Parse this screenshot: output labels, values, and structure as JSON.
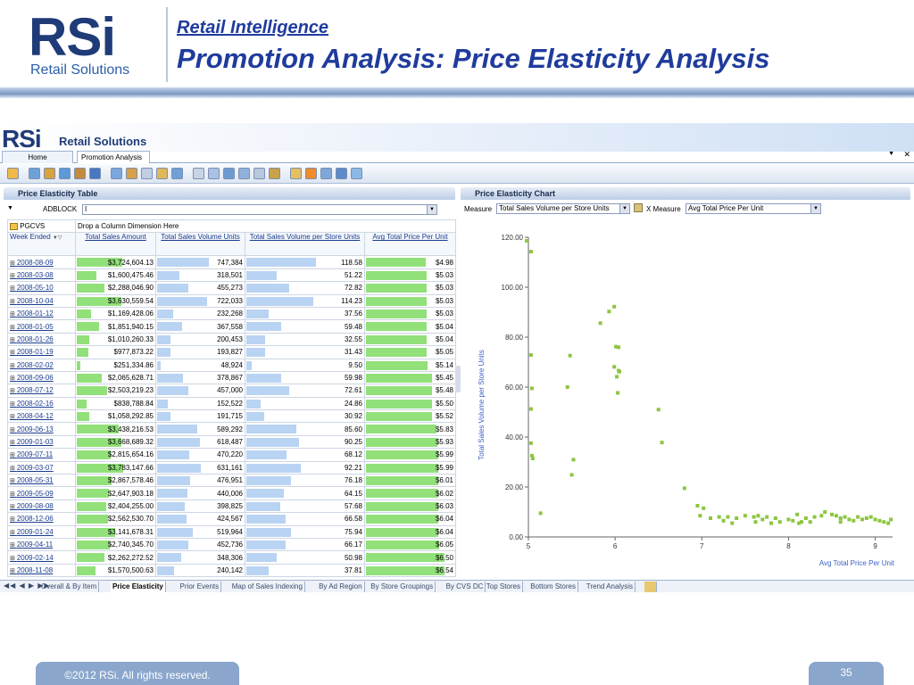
{
  "slide": {
    "logo_text": "RSi",
    "logo_sub": "Retail Solutions",
    "kicker": "Retail Intelligence",
    "title": "Promotion Analysis: Price Elasticity Analysis",
    "footer": "©2012 RSi. All rights reserved.",
    "page_number": "35"
  },
  "app": {
    "brand": "RSi",
    "brand_sub": "Retail Solutions",
    "tabs": [
      "Home",
      "Promotion Analysis"
    ],
    "left_panel_title": "Price Elasticity Table",
    "right_panel_title": "Price Elasticity Chart",
    "filter_label": "ADBLOCK",
    "filter_value": "I",
    "pgcvs_label": "PGCVS",
    "drop_hint": "Drop a Column Dimension Here",
    "row_header": "Week Ended",
    "columns": [
      "Total Sales Amount",
      "Total Sales Volume Units",
      "Total Sales Volume per Store Units",
      "Avg Total Price Per Unit"
    ],
    "rows": [
      [
        "2008-08-09",
        "$3,724,604.13",
        "747,384",
        "118.58",
        "$4.98"
      ],
      [
        "2008-03-08",
        "$1,600,475.46",
        "318,501",
        "51.22",
        "$5.03"
      ],
      [
        "2008-05-10",
        "$2,288,046.90",
        "455,273",
        "72.82",
        "$5.03"
      ],
      [
        "2008-10-04",
        "$3,630,559.54",
        "722,033",
        "114.23",
        "$5.03"
      ],
      [
        "2008-01-12",
        "$1,169,428.06",
        "232,268",
        "37.56",
        "$5.03"
      ],
      [
        "2008-01-05",
        "$1,851,940.15",
        "367,558",
        "59.48",
        "$5.04"
      ],
      [
        "2008-01-26",
        "$1,010,260.33",
        "200,453",
        "32.55",
        "$5.04"
      ],
      [
        "2008-01-19",
        "$977,873.22",
        "193,827",
        "31.43",
        "$5.05"
      ],
      [
        "2008-02-02",
        "$251,334.86",
        "48,924",
        "9.50",
        "$5.14"
      ],
      [
        "2008-09-06",
        "$2,065,628.71",
        "378,867",
        "59.98",
        "$5.45"
      ],
      [
        "2008-07-12",
        "$2,503,219.23",
        "457,000",
        "72.61",
        "$5.48"
      ],
      [
        "2008-02-16",
        "$838,788.84",
        "152,522",
        "24.86",
        "$5.50"
      ],
      [
        "2008-04-12",
        "$1,058,292.85",
        "191,715",
        "30.92",
        "$5.52"
      ],
      [
        "2009-06-13",
        "$3,438,216.53",
        "589,292",
        "85.60",
        "$5.83"
      ],
      [
        "2009-01-03",
        "$3,668,689.32",
        "618,487",
        "90.25",
        "$5.93"
      ],
      [
        "2009-07-11",
        "$2,815,654.16",
        "470,220",
        "68.12",
        "$5.99"
      ],
      [
        "2009-03-07",
        "$3,783,147.66",
        "631,161",
        "92.21",
        "$5.99"
      ],
      [
        "2008-05-31",
        "$2,867,578.46",
        "476,951",
        "76.18",
        "$6.01"
      ],
      [
        "2009-05-09",
        "$2,647,903.18",
        "440,006",
        "64.15",
        "$6.02"
      ],
      [
        "2009-08-08",
        "$2,404,255.00",
        "398,825",
        "57.68",
        "$6.03"
      ],
      [
        "2008-12-06",
        "$2,562,530.70",
        "424,567",
        "66.58",
        "$6.04"
      ],
      [
        "2009-01-24",
        "$3,141,678.31",
        "519,964",
        "75.94",
        "$6.04"
      ],
      [
        "2009-04-11",
        "$2,740,345.70",
        "452,736",
        "66.17",
        "$6.05"
      ],
      [
        "2009-02-14",
        "$2,262,272.52",
        "348,306",
        "50.98",
        "$6.50"
      ],
      [
        "2008-11-08",
        "$1,570,500.63",
        "240,142",
        "37.81",
        "$6.54"
      ]
    ],
    "measure_label": "Measure",
    "measure_value": "Total Sales Volume per Store Units",
    "x_measure_label": "X Measure",
    "x_measure_value": "Avg Total Price Per Unit",
    "bottom_tabs": [
      "Overall & By Item",
      "Price Elasticity",
      "Prior Events",
      "Map of Sales Indexing",
      "By Ad Region",
      "By Store Groupings",
      "By CVS DC",
      "Top Stores",
      "Bottom Stores",
      "Trend Analysis"
    ]
  },
  "colors": {
    "brand": "#1f3b78",
    "bar_green": "#92e07a",
    "bar_blue": "#b9d3f3",
    "point": "#8cc63f",
    "axis_title": "#3b5fc5"
  },
  "chart_data": {
    "type": "scatter",
    "xlabel": "Avg Total Price Per Unit",
    "ylabel": "Total Sales Volume per Store Units",
    "xlim": [
      5,
      9.2
    ],
    "ylim": [
      0,
      120
    ],
    "x_ticks": [
      "5",
      "6",
      "7",
      "8",
      "9"
    ],
    "y_ticks": [
      "0.00",
      "20.00",
      "40.00",
      "60.00",
      "80.00",
      "100.00",
      "120.00"
    ],
    "grid": false,
    "points": [
      [
        4.98,
        118.58
      ],
      [
        5.03,
        114.23
      ],
      [
        5.03,
        72.82
      ],
      [
        5.03,
        51.22
      ],
      [
        5.03,
        37.56
      ],
      [
        5.04,
        59.48
      ],
      [
        5.04,
        32.55
      ],
      [
        5.05,
        31.43
      ],
      [
        5.14,
        9.5
      ],
      [
        5.45,
        59.98
      ],
      [
        5.48,
        72.61
      ],
      [
        5.5,
        24.86
      ],
      [
        5.52,
        30.92
      ],
      [
        5.83,
        85.6
      ],
      [
        5.93,
        90.25
      ],
      [
        5.99,
        68.12
      ],
      [
        5.99,
        92.21
      ],
      [
        6.01,
        76.18
      ],
      [
        6.02,
        64.15
      ],
      [
        6.03,
        57.68
      ],
      [
        6.04,
        66.58
      ],
      [
        6.04,
        75.94
      ],
      [
        6.05,
        66.17
      ],
      [
        6.5,
        50.98
      ],
      [
        6.54,
        37.81
      ],
      [
        6.8,
        19.5
      ],
      [
        6.95,
        12.5
      ],
      [
        6.98,
        8.5
      ],
      [
        7.02,
        11.5
      ],
      [
        7.1,
        7.5
      ],
      [
        7.2,
        8
      ],
      [
        7.25,
        6.5
      ],
      [
        7.3,
        8
      ],
      [
        7.35,
        5.5
      ],
      [
        7.4,
        7.5
      ],
      [
        7.5,
        8.5
      ],
      [
        7.6,
        8
      ],
      [
        7.62,
        6
      ],
      [
        7.65,
        8.5
      ],
      [
        7.7,
        7
      ],
      [
        7.75,
        8
      ],
      [
        7.8,
        5.5
      ],
      [
        7.85,
        7.5
      ],
      [
        7.9,
        6
      ],
      [
        8.0,
        7
      ],
      [
        8.05,
        6.5
      ],
      [
        8.1,
        9
      ],
      [
        8.15,
        6
      ],
      [
        8.2,
        7.5
      ],
      [
        8.25,
        6
      ],
      [
        8.3,
        8
      ],
      [
        8.38,
        8.5
      ],
      [
        8.42,
        10
      ],
      [
        8.5,
        9
      ],
      [
        8.55,
        8.5
      ],
      [
        8.6,
        7.5
      ],
      [
        8.65,
        8
      ],
      [
        8.7,
        7
      ],
      [
        8.75,
        6.5
      ],
      [
        8.8,
        8
      ],
      [
        8.85,
        7
      ],
      [
        8.9,
        7.5
      ],
      [
        8.95,
        8
      ],
      [
        9.0,
        7
      ],
      [
        9.05,
        6.5
      ],
      [
        9.1,
        6
      ],
      [
        9.15,
        5.5
      ],
      [
        9.18,
        7
      ],
      [
        8.6,
        6
      ],
      [
        8.12,
        5.5
      ]
    ]
  }
}
